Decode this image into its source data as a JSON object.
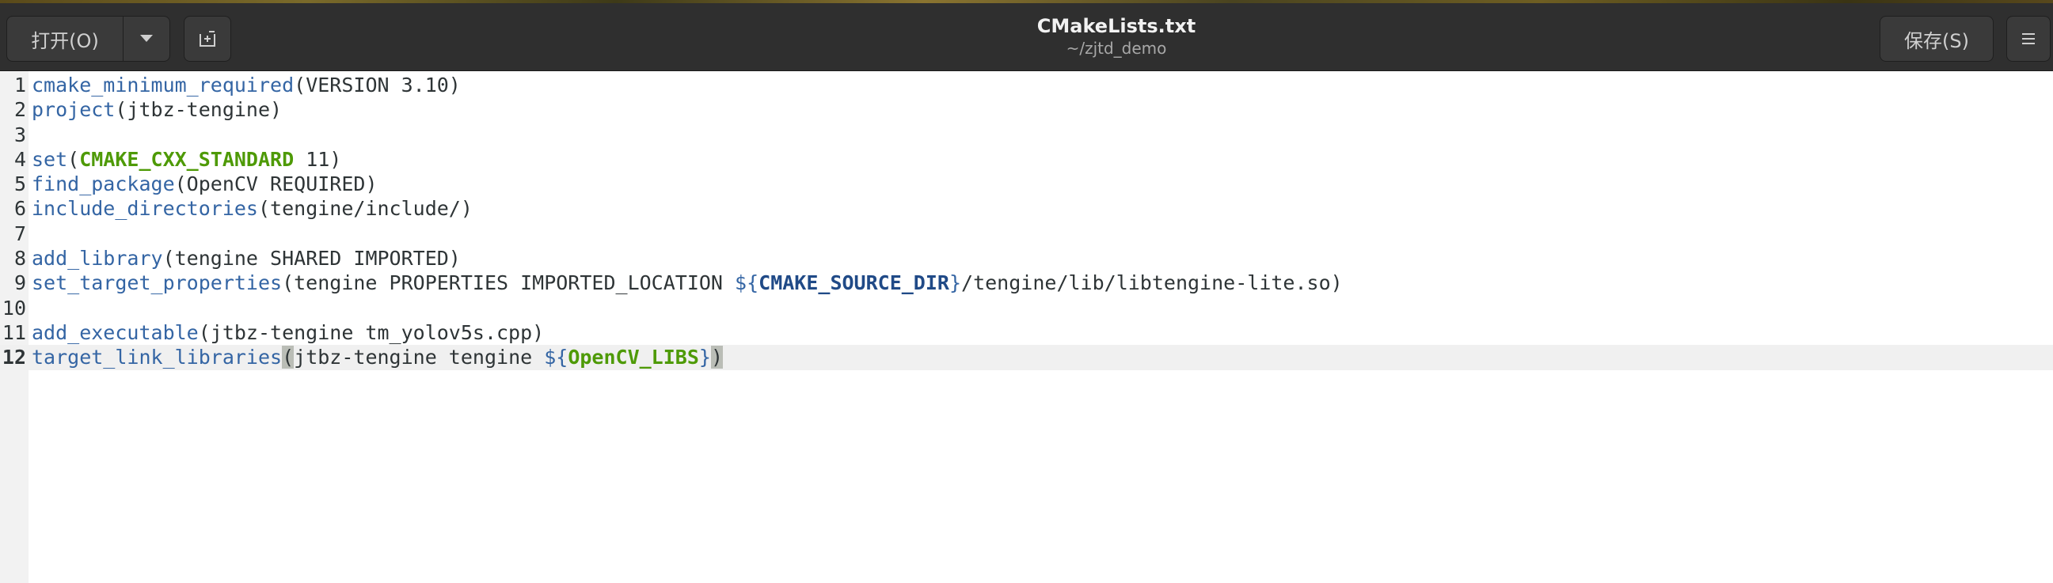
{
  "window": {
    "title": "CMakeLists.txt",
    "subtitle": "~/zjtd_demo"
  },
  "toolbar": {
    "open_label": "打开(O)",
    "open_menu_icon": "chevron-down-icon",
    "new_tab_icon": "new-document-icon",
    "save_label": "保存(S)",
    "menu_icon": "hamburger-menu-icon"
  },
  "editor": {
    "current_line": 12,
    "lines": [
      {
        "n": "1",
        "segments": [
          {
            "t": "cmake_minimum_required",
            "c": "kw"
          },
          {
            "t": "(VERSION 3.10)",
            "c": ""
          }
        ]
      },
      {
        "n": "2",
        "segments": [
          {
            "t": "project",
            "c": "kw"
          },
          {
            "t": "(jtbz-tengine)",
            "c": ""
          }
        ]
      },
      {
        "n": "3",
        "segments": []
      },
      {
        "n": "4",
        "segments": [
          {
            "t": "set",
            "c": "kw"
          },
          {
            "t": "(",
            "c": ""
          },
          {
            "t": "CMAKE_CXX_STANDARD",
            "c": "var"
          },
          {
            "t": " 11)",
            "c": ""
          }
        ]
      },
      {
        "n": "5",
        "segments": [
          {
            "t": "find_package",
            "c": "kw"
          },
          {
            "t": "(OpenCV REQUIRED)",
            "c": ""
          }
        ]
      },
      {
        "n": "6",
        "segments": [
          {
            "t": "include_directories",
            "c": "kw"
          },
          {
            "t": "(tengine/include/)",
            "c": ""
          }
        ]
      },
      {
        "n": "7",
        "segments": []
      },
      {
        "n": "8",
        "segments": [
          {
            "t": "add_library",
            "c": "kw"
          },
          {
            "t": "(tengine SHARED IMPORTED)",
            "c": ""
          }
        ]
      },
      {
        "n": "9",
        "segments": [
          {
            "t": "set_target_properties",
            "c": "kw"
          },
          {
            "t": "(tengine PROPERTIES IMPORTED_LOCATION ",
            "c": ""
          },
          {
            "t": "${",
            "c": "kw"
          },
          {
            "t": "CMAKE_SOURCE_DIR",
            "c": "var-blue"
          },
          {
            "t": "}",
            "c": "kw"
          },
          {
            "t": "/tengine/lib/libtengine-lite.so)",
            "c": ""
          }
        ]
      },
      {
        "n": "10",
        "segments": []
      },
      {
        "n": "11",
        "segments": [
          {
            "t": "add_executable",
            "c": "kw"
          },
          {
            "t": "(jtbz-tengine tm_yolov5s.cpp)",
            "c": ""
          }
        ]
      },
      {
        "n": "12",
        "segments": [
          {
            "t": "target_link_libraries",
            "c": "kw"
          },
          {
            "t": "(",
            "c": "bracket-match"
          },
          {
            "t": "jtbz-tengine tengine ",
            "c": ""
          },
          {
            "t": "${",
            "c": "kw"
          },
          {
            "t": "OpenCV_LIBS",
            "c": "var"
          },
          {
            "t": "}",
            "c": "kw"
          },
          {
            "t": ")",
            "c": "bracket-match"
          }
        ]
      }
    ]
  },
  "colors": {
    "headerbar": "#2f2f2f",
    "keyword": "#3465a4",
    "variable_green": "#4e9a06",
    "variable_blue": "#204a87",
    "current_line": "#f0f0f0",
    "bracket_match": "#babdb6"
  }
}
